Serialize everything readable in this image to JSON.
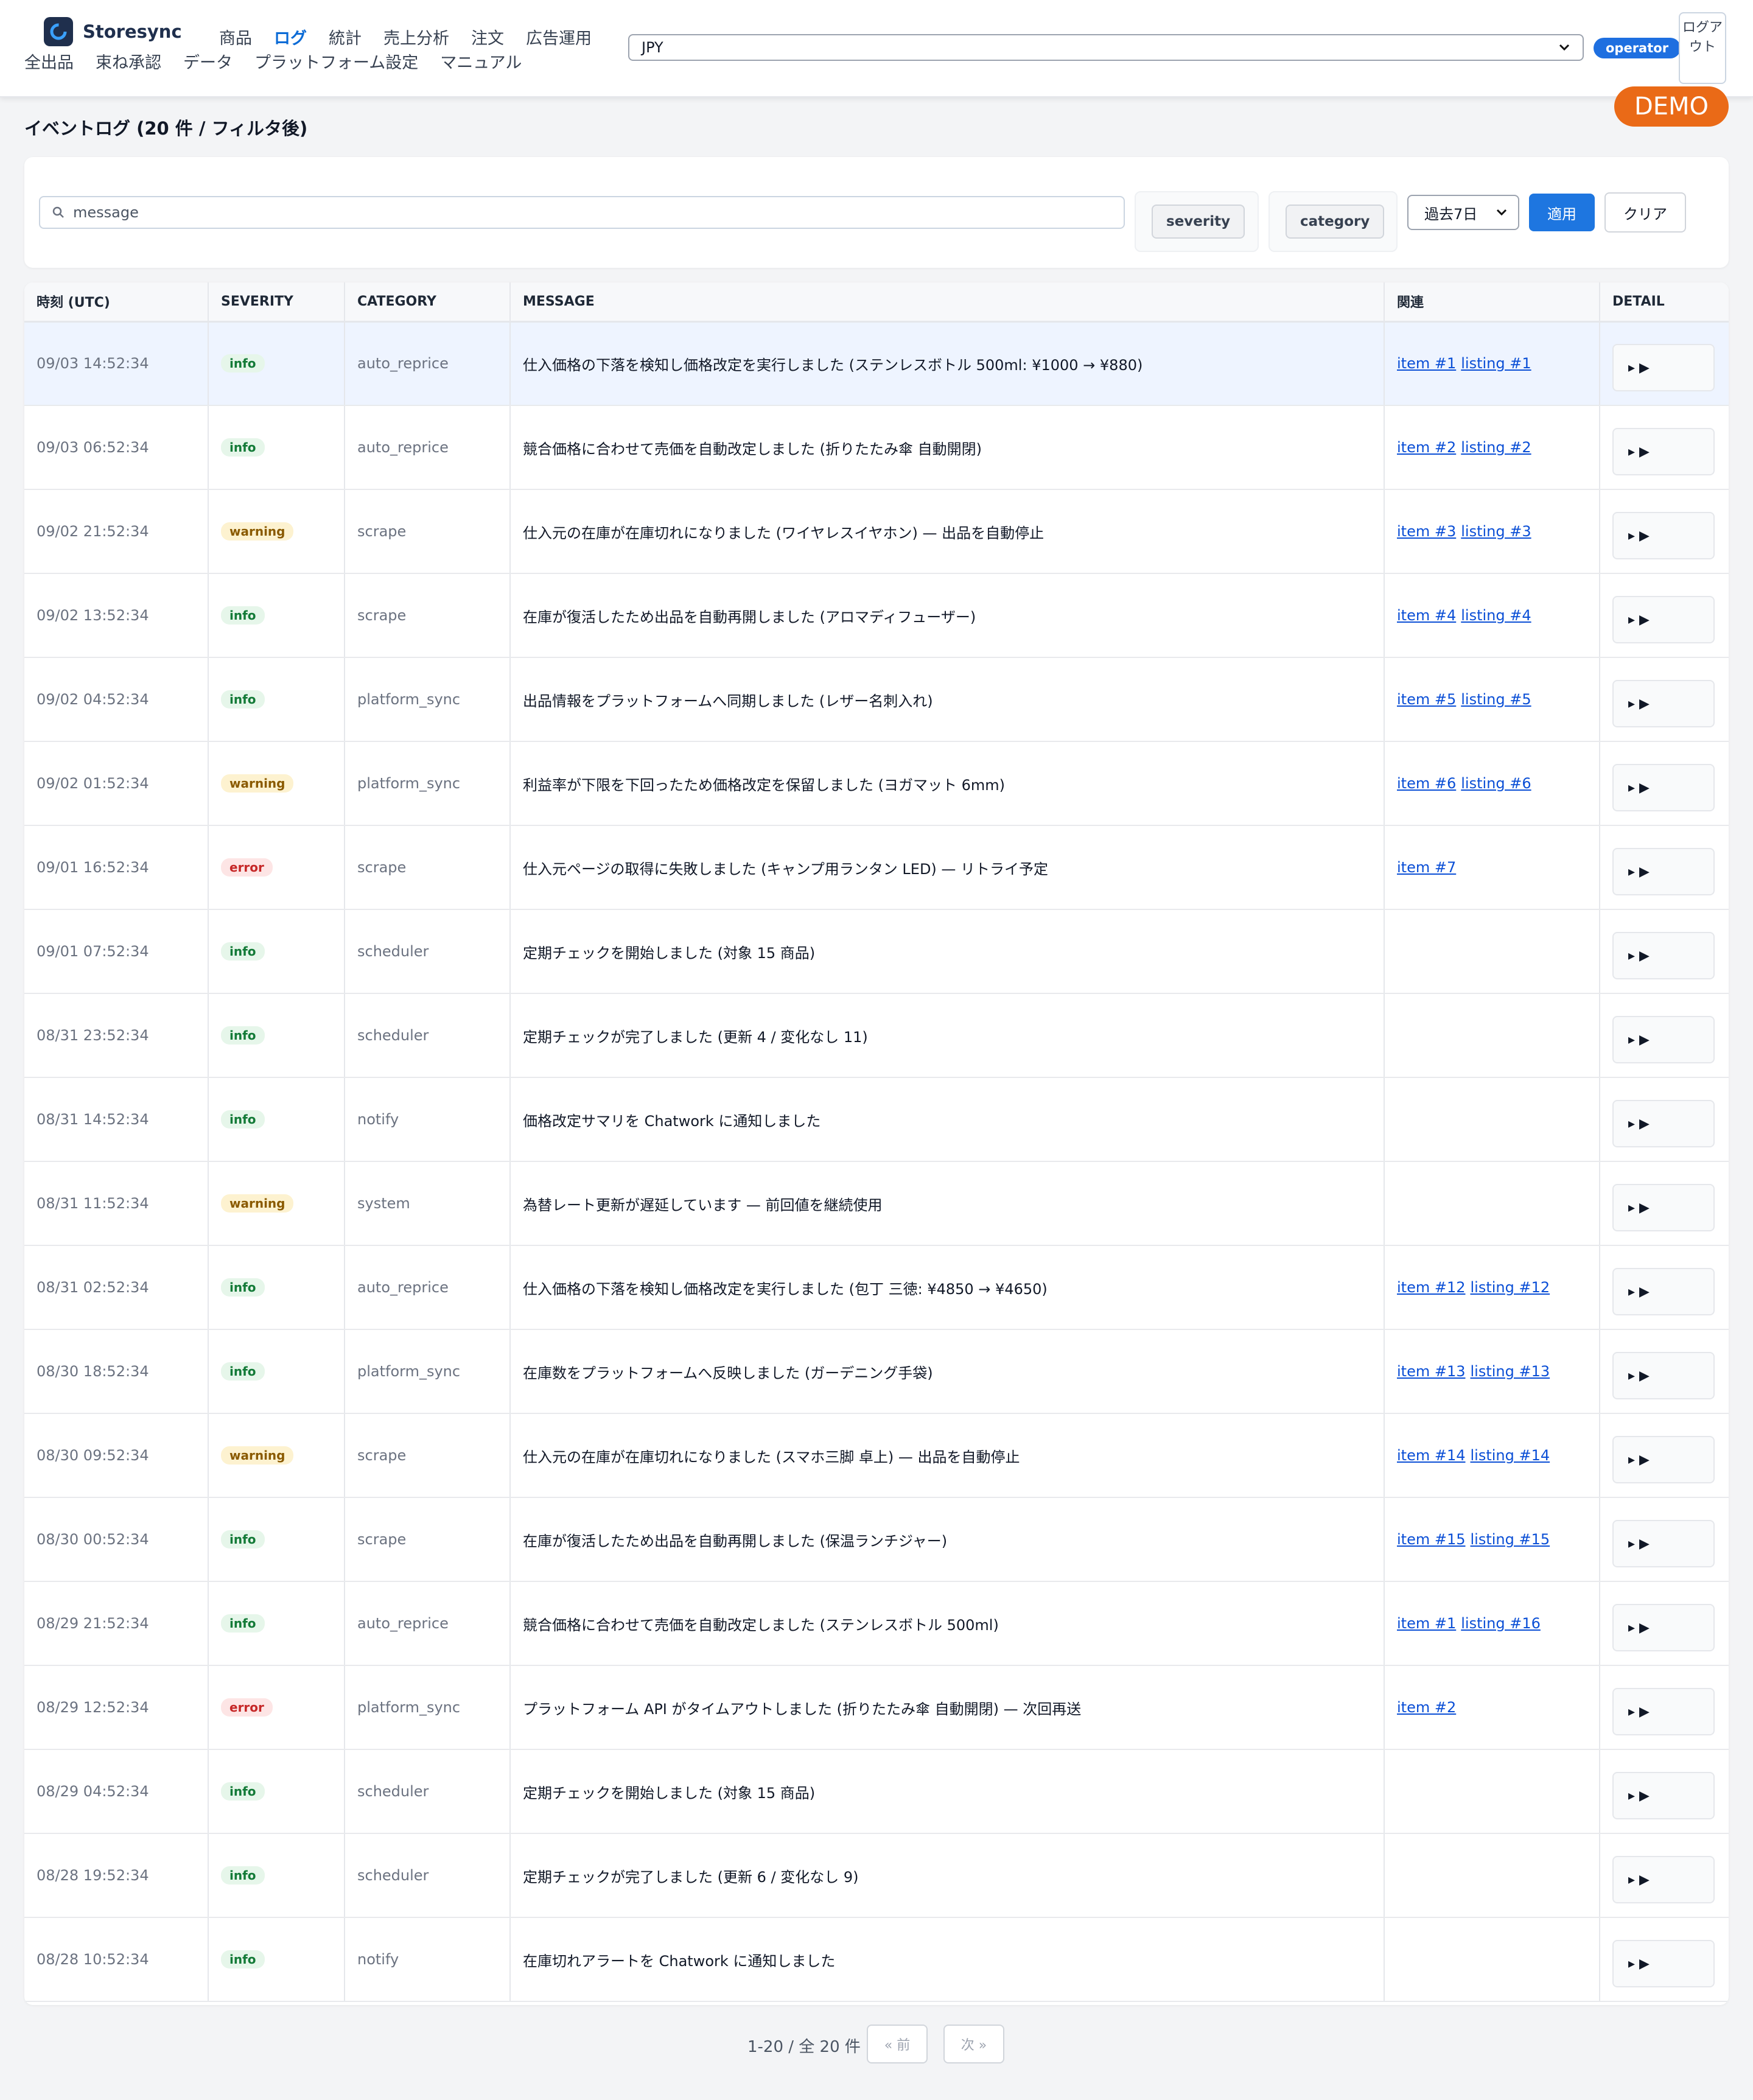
{
  "header": {
    "brand": "Storesync",
    "nav": [
      "商品",
      "ログ",
      "統計",
      "売上分析",
      "注文",
      "広告運用",
      "全出品",
      "束ね承認",
      "データ",
      "プラットフォーム設定",
      "マニュアル"
    ],
    "active_nav": "ログ",
    "currency": "JPY",
    "role": "operator",
    "logout": "ログアウト",
    "demo": "DEMO"
  },
  "page": {
    "title": "イベントログ (20 件 / フィルタ後)"
  },
  "filters": {
    "search_placeholder": "message",
    "severity": "severity",
    "category": "category",
    "range": "過去7日",
    "apply": "適用",
    "clear": "クリア"
  },
  "table": {
    "columns": [
      "時刻 (UTC)",
      "SEVERITY",
      "CATEGORY",
      "MESSAGE",
      "関連",
      "DETAIL"
    ],
    "rows": [
      {
        "time": "09/03 14:52:34",
        "severity": "info",
        "category": "auto_reprice",
        "message": "仕入価格の下落を検知し価格改定を実行しました (ステンレスボトル 500ml: ¥1000 → ¥880)",
        "item": "item #1",
        "listing": "listing #1"
      },
      {
        "time": "09/03 06:52:34",
        "severity": "info",
        "category": "auto_reprice",
        "message": "競合価格に合わせて売価を自動改定しました (折りたたみ傘 自動開閉)",
        "item": "item #2",
        "listing": "listing #2"
      },
      {
        "time": "09/02 21:52:34",
        "severity": "warning",
        "category": "scrape",
        "message": "仕入元の在庫が在庫切れになりました (ワイヤレスイヤホン) — 出品を自動停止",
        "item": "item #3",
        "listing": "listing #3"
      },
      {
        "time": "09/02 13:52:34",
        "severity": "info",
        "category": "scrape",
        "message": "在庫が復活したため出品を自動再開しました (アロマディフューザー)",
        "item": "item #4",
        "listing": "listing #4"
      },
      {
        "time": "09/02 04:52:34",
        "severity": "info",
        "category": "platform_sync",
        "message": "出品情報をプラットフォームへ同期しました (レザー名刺入れ)",
        "item": "item #5",
        "listing": "listing #5"
      },
      {
        "time": "09/02 01:52:34",
        "severity": "warning",
        "category": "platform_sync",
        "message": "利益率が下限を下回ったため価格改定を保留しました (ヨガマット 6mm)",
        "item": "item #6",
        "listing": "listing #6"
      },
      {
        "time": "09/01 16:52:34",
        "severity": "error",
        "category": "scrape",
        "message": "仕入元ページの取得に失敗しました (キャンプ用ランタン LED) — リトライ予定",
        "item": "item #7",
        "listing": ""
      },
      {
        "time": "09/01 07:52:34",
        "severity": "info",
        "category": "scheduler",
        "message": "定期チェックを開始しました (対象 15 商品)",
        "item": "",
        "listing": ""
      },
      {
        "time": "08/31 23:52:34",
        "severity": "info",
        "category": "scheduler",
        "message": "定期チェックが完了しました (更新 4 / 変化なし 11)",
        "item": "",
        "listing": ""
      },
      {
        "time": "08/31 14:52:34",
        "severity": "info",
        "category": "notify",
        "message": "価格改定サマリを Chatwork に通知しました",
        "item": "",
        "listing": ""
      },
      {
        "time": "08/31 11:52:34",
        "severity": "warning",
        "category": "system",
        "message": "為替レート更新が遅延しています — 前回値を継続使用",
        "item": "",
        "listing": ""
      },
      {
        "time": "08/31 02:52:34",
        "severity": "info",
        "category": "auto_reprice",
        "message": "仕入価格の下落を検知し価格改定を実行しました (包丁 三徳: ¥4850 → ¥4650)",
        "item": "item #12",
        "listing": "listing #12"
      },
      {
        "time": "08/30 18:52:34",
        "severity": "info",
        "category": "platform_sync",
        "message": "在庫数をプラットフォームへ反映しました (ガーデニング手袋)",
        "item": "item #13",
        "listing": "listing #13"
      },
      {
        "time": "08/30 09:52:34",
        "severity": "warning",
        "category": "scrape",
        "message": "仕入元の在庫が在庫切れになりました (スマホ三脚 卓上) — 出品を自動停止",
        "item": "item #14",
        "listing": "listing #14"
      },
      {
        "time": "08/30 00:52:34",
        "severity": "info",
        "category": "scrape",
        "message": "在庫が復活したため出品を自動再開しました (保温ランチジャー)",
        "item": "item #15",
        "listing": "listing #15"
      },
      {
        "time": "08/29 21:52:34",
        "severity": "info",
        "category": "auto_reprice",
        "message": "競合価格に合わせて売価を自動改定しました (ステンレスボトル 500ml)",
        "item": "item #1",
        "listing": "listing #16"
      },
      {
        "time": "08/29 12:52:34",
        "severity": "error",
        "category": "platform_sync",
        "message": "プラットフォーム API がタイムアウトしました (折りたたみ傘 自動開閉) — 次回再送",
        "item": "item #2",
        "listing": ""
      },
      {
        "time": "08/29 04:52:34",
        "severity": "info",
        "category": "scheduler",
        "message": "定期チェックを開始しました (対象 15 商品)",
        "item": "",
        "listing": ""
      },
      {
        "time": "08/28 19:52:34",
        "severity": "info",
        "category": "scheduler",
        "message": "定期チェックが完了しました (更新 6 / 変化なし 9)",
        "item": "",
        "listing": ""
      },
      {
        "time": "08/28 10:52:34",
        "severity": "info",
        "category": "notify",
        "message": "在庫切れアラートを Chatwork に通知しました",
        "item": "",
        "listing": ""
      }
    ],
    "detail_label": "▸ ▶"
  },
  "pagination": {
    "summary": "1-20 / 全 20 件",
    "prev": "« 前",
    "next": "次 »"
  }
}
